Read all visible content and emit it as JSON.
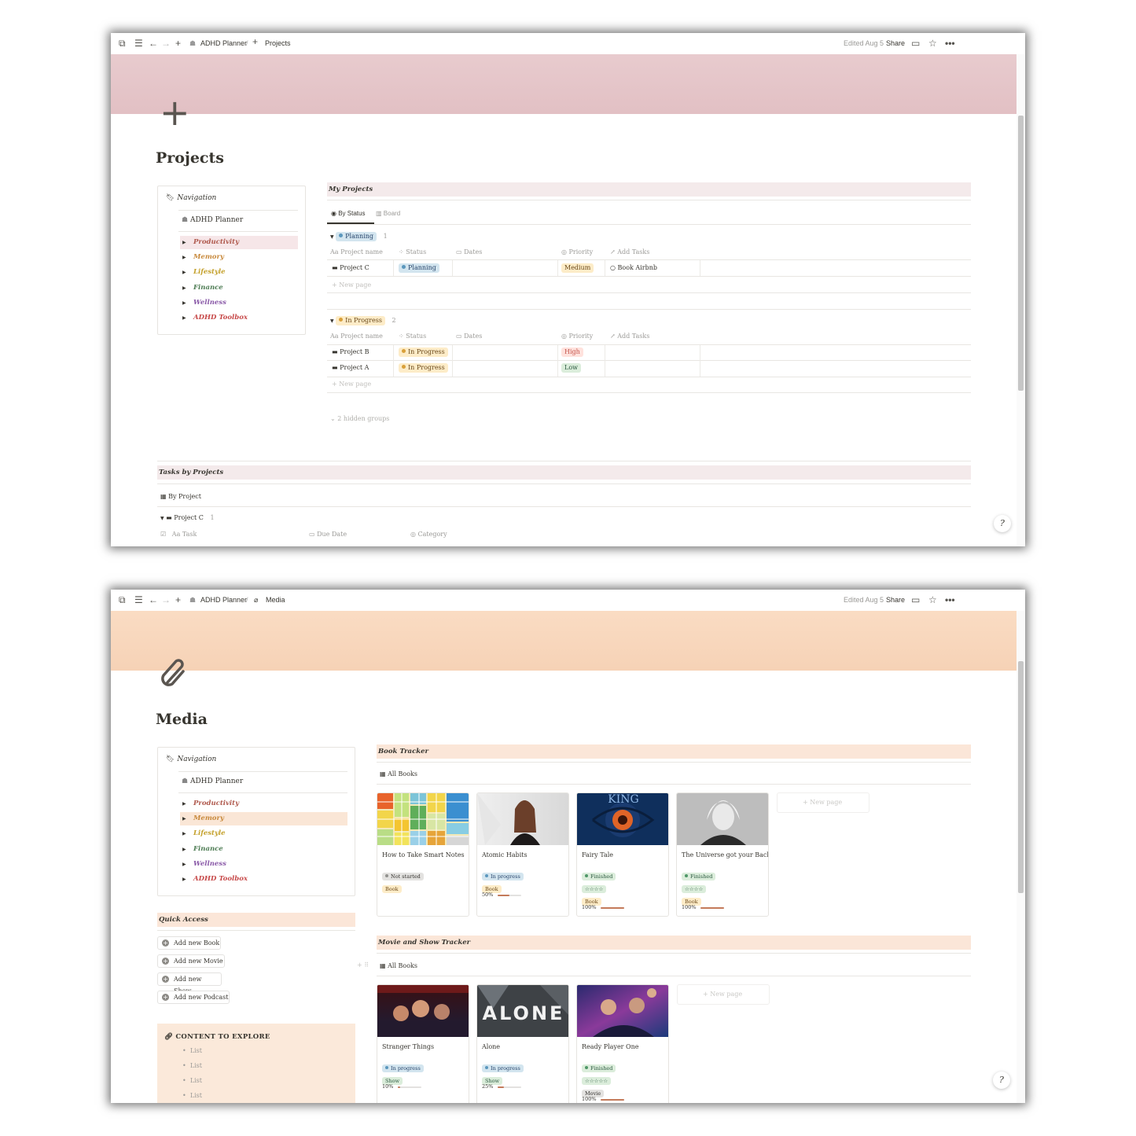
{
  "topbar": {
    "crumb_root": "ADHD Planner",
    "edited": "Edited Aug 5",
    "share": "Share"
  },
  "projects_page": {
    "crumb_page": "Projects",
    "title": "Projects",
    "cover_color": "#e6c5c9",
    "navigation": {
      "heading": "Navigation",
      "planner": "ADHD Planner",
      "items": [
        {
          "label": "Productivity",
          "color": "#b05a4e"
        },
        {
          "label": "Memory",
          "color": "#c88a3d"
        },
        {
          "label": "Lifestyle",
          "color": "#c4a02a"
        },
        {
          "label": "Finance",
          "color": "#4f7d55"
        },
        {
          "label": "Wellness",
          "color": "#8a5aa8"
        },
        {
          "label": "ADHD Toolbox",
          "color": "#c74a4a"
        }
      ]
    },
    "my_projects": {
      "heading": "My Projects",
      "tabs": [
        "By Status",
        "Board"
      ],
      "columns": [
        "Project name",
        "Status",
        "Dates",
        "Priority",
        "Add Tasks"
      ],
      "groups": [
        {
          "name": "Planning",
          "count": "1",
          "rows": [
            {
              "name": "Project C",
              "status": "Planning",
              "priority": "Medium",
              "task": "Book Airbnb"
            }
          ]
        },
        {
          "name": "In Progress",
          "count": "2",
          "rows": [
            {
              "name": "Project B",
              "status": "In Progress",
              "priority": "High",
              "task": ""
            },
            {
              "name": "Project A",
              "status": "In Progress",
              "priority": "Low",
              "task": ""
            }
          ]
        }
      ],
      "new_page": "New page",
      "hidden_groups": "2 hidden groups"
    },
    "tasks_by_projects": {
      "heading": "Tasks by Projects",
      "view": "By Project",
      "group": "Project C",
      "group_count": "1",
      "columns": [
        "Task",
        "Due Date",
        "Category"
      ]
    }
  },
  "media_page": {
    "crumb_page": "Media",
    "title": "Media",
    "cover_color": "#f8d9bf",
    "navigation": {
      "heading": "Navigation",
      "planner": "ADHD Planner",
      "items": [
        {
          "label": "Productivity",
          "color": "#b05a4e"
        },
        {
          "label": "Memory",
          "color": "#c88a3d"
        },
        {
          "label": "Lifestyle",
          "color": "#c4a02a"
        },
        {
          "label": "Finance",
          "color": "#4f7d55"
        },
        {
          "label": "Wellness",
          "color": "#8a5aa8"
        },
        {
          "label": "ADHD Toolbox",
          "color": "#c74a4a"
        }
      ]
    },
    "quick_access": {
      "heading": "Quick Access",
      "buttons": [
        "Add new Book",
        "Add new Movie",
        "Add new Show",
        "Add new Podcast"
      ]
    },
    "content_to_explore": {
      "heading": "CONTENT TO EXPLORE",
      "items": [
        "List",
        "List",
        "List",
        "List"
      ]
    },
    "book_tracker": {
      "heading": "Book Tracker",
      "view": "All Books",
      "new_page": "New page",
      "cards": [
        {
          "title": "How to Take Smart Notes",
          "status": "Not started",
          "type": "Book",
          "stars": "",
          "progress": ""
        },
        {
          "title": "Atomic Habits",
          "status": "In progress",
          "type": "Book",
          "stars": "",
          "progress": "50%"
        },
        {
          "title": "Fairy Tale",
          "status": "Finished",
          "type": "Book",
          "stars": "☆☆☆☆",
          "progress": "100%",
          "cover_text": "KING"
        },
        {
          "title": "The Universe got your Back",
          "status": "Finished",
          "type": "Book",
          "stars": "☆☆☆☆",
          "progress": "100%"
        }
      ]
    },
    "movie_tracker": {
      "heading": "Movie and Show Tracker",
      "view": "All Books",
      "new_page": "New page",
      "cards": [
        {
          "title": "Stranger Things",
          "status": "In progress",
          "type": "Show",
          "stars": "",
          "progress": "10%"
        },
        {
          "title": "Alone",
          "status": "In progress",
          "type": "Show",
          "stars": "",
          "progress": "25%",
          "cover_text": "ALONE"
        },
        {
          "title": "Ready Player One",
          "status": "Finished",
          "type": "Movie",
          "stars": "☆☆☆☆☆",
          "progress": "100%"
        }
      ]
    }
  }
}
